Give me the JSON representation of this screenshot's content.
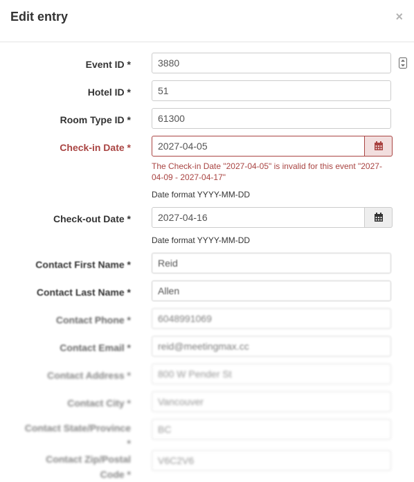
{
  "modal": {
    "title": "Edit entry",
    "close_label": "×"
  },
  "fields": {
    "event_id": {
      "label": "Event ID *",
      "value": "3880"
    },
    "hotel_id": {
      "label": "Hotel ID *",
      "value": "51"
    },
    "room_type_id": {
      "label": "Room Type ID *",
      "value": "61300"
    },
    "checkin_date": {
      "label": "Check-in Date *",
      "value": "2027-04-05",
      "error": "The Check-in Date \"2027-04-05\" is invalid for this event \"2027-04-09 - 2027-04-17\"",
      "help": "Date format YYYY-MM-DD"
    },
    "checkout_date": {
      "label": "Check-out Date *",
      "value": "2027-04-16",
      "help": "Date format YYYY-MM-DD"
    },
    "contact_first_name": {
      "label": "Contact First Name *",
      "value": "Reid"
    },
    "contact_last_name": {
      "label": "Contact Last Name *",
      "value": "Allen"
    },
    "contact_phone": {
      "label": "Contact Phone *",
      "value": "6048991069"
    },
    "contact_email": {
      "label": "Contact Email *",
      "value": "reid@meetingmax.cc"
    },
    "contact_address": {
      "label": "Contact Address *",
      "value": "800 W Pender St"
    },
    "contact_city": {
      "label": "Contact City *",
      "value": "Vancouver"
    },
    "contact_state": {
      "label": "Contact State/Province *",
      "value": "BC"
    },
    "contact_zip": {
      "label": "Contact Zip/Postal Code *",
      "value": "V6C2V6"
    }
  },
  "colors": {
    "error": "#a94442",
    "error_bg": "#f2dede",
    "addon_bg": "#eeeeee",
    "border": "#cccccc"
  },
  "icons": {
    "calendar": "calendar-icon",
    "stepper": "number-stepper-icon",
    "close": "close-icon"
  }
}
